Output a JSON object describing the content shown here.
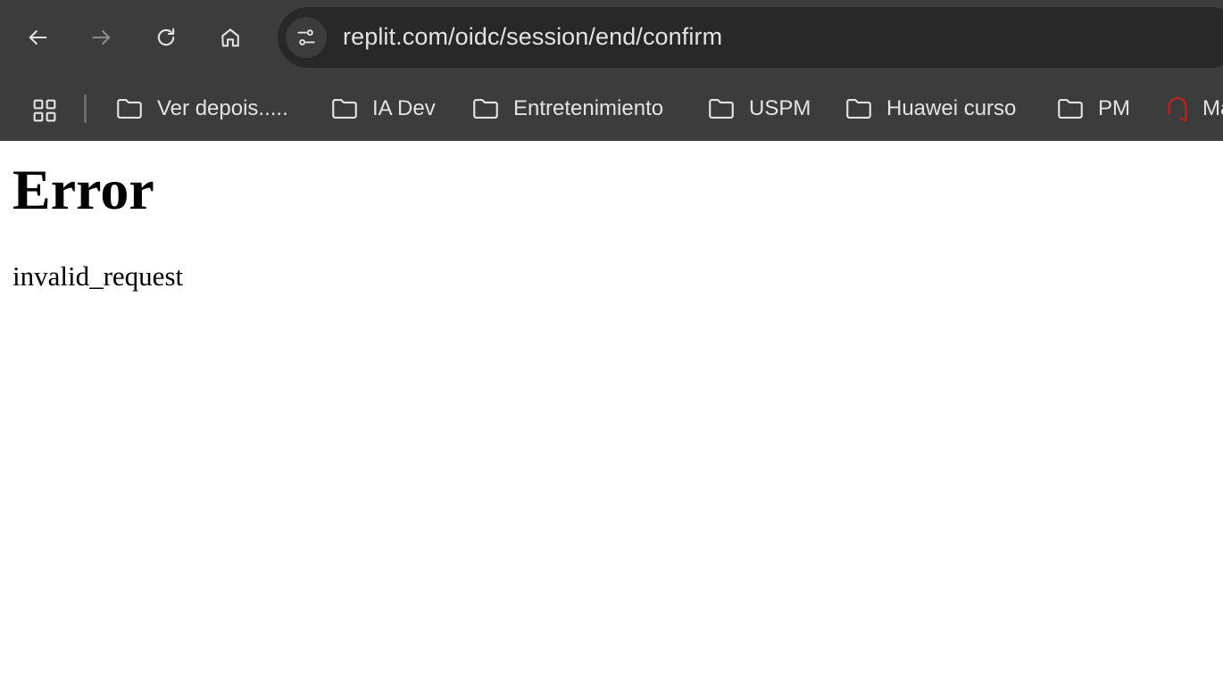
{
  "browser": {
    "address_bar": {
      "url": "replit.com/oidc/session/end/confirm"
    },
    "nav_icons": [
      "back-arrow-icon",
      "forward-arrow-icon",
      "reload-icon",
      "home-icon"
    ],
    "bookmarks": [
      {
        "label": "Ver depois.....",
        "icon": "folder-icon"
      },
      {
        "label": "IA Dev",
        "icon": "folder-icon"
      },
      {
        "label": "Entretenimiento",
        "icon": "folder-icon"
      },
      {
        "label": "USPM",
        "icon": "folder-icon"
      },
      {
        "label": "Huawei curso",
        "icon": "folder-icon"
      },
      {
        "label": "PM",
        "icon": "folder-icon"
      },
      {
        "label": "Ma",
        "icon": "site-favicon-icon"
      }
    ]
  },
  "page": {
    "heading": "Error",
    "message": "invalid_request"
  },
  "colors": {
    "chrome_background": "#3c3c3c",
    "omnibox_background": "#282828",
    "chrome_text": "#e3e3e3",
    "forward_disabled": "#8a8a8a",
    "favicon_accent": "#b3261e",
    "page_background": "#ffffff",
    "page_text": "#000000"
  }
}
